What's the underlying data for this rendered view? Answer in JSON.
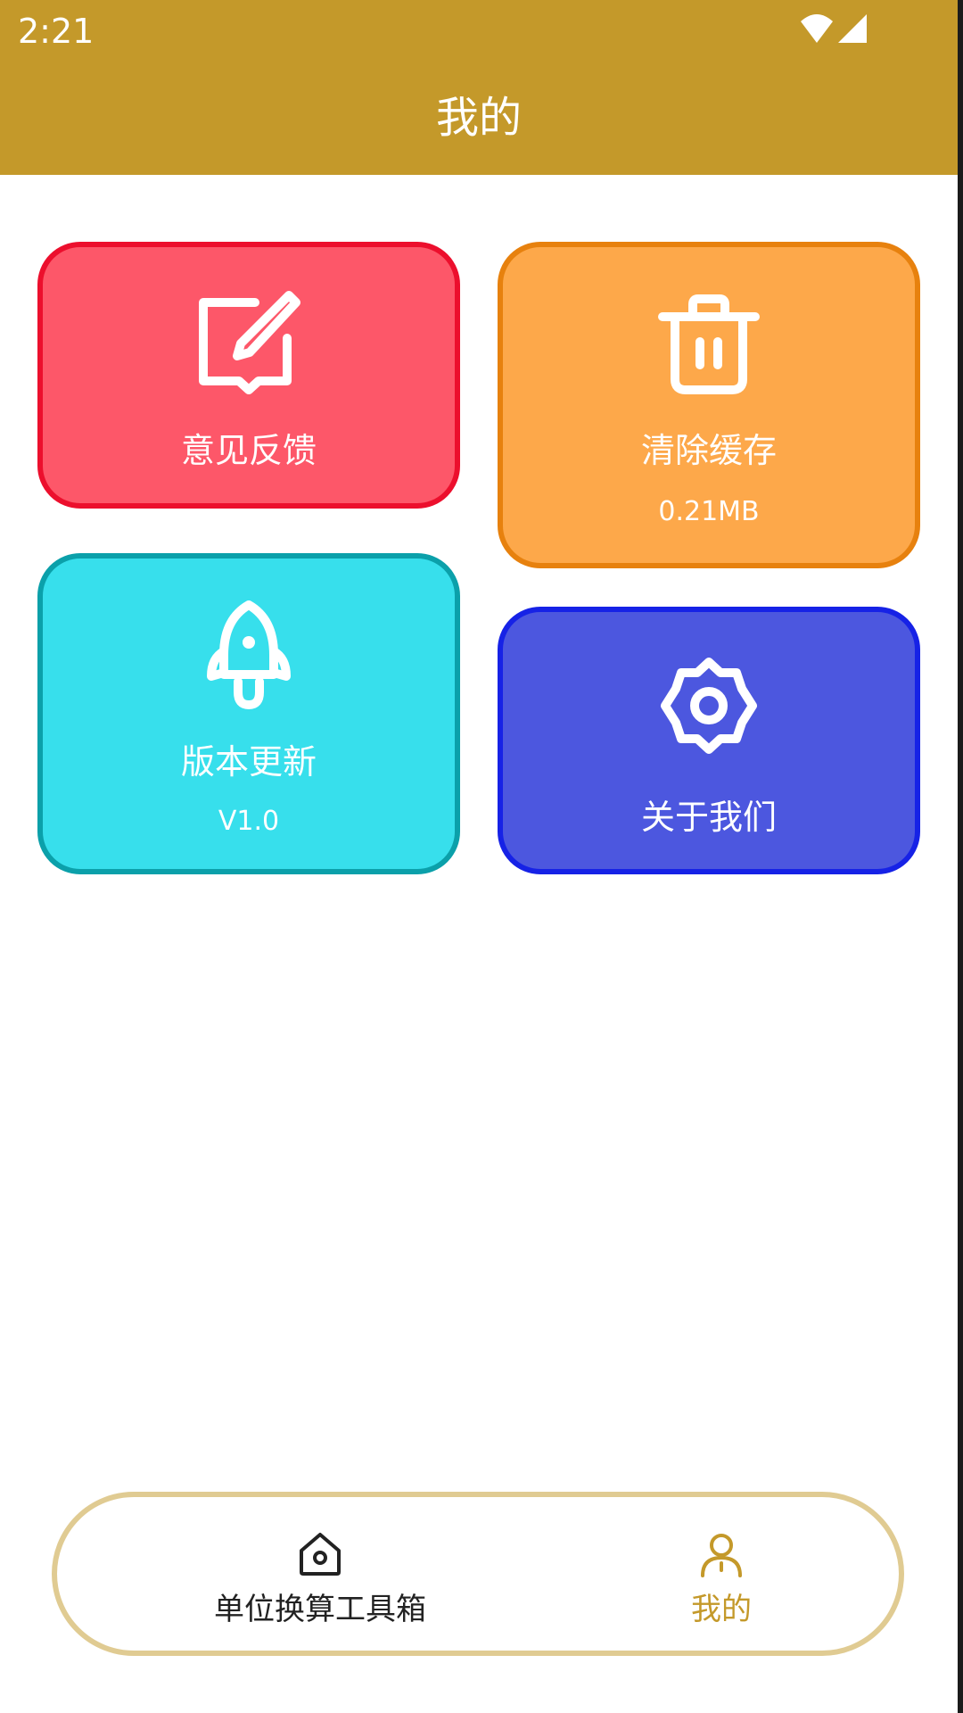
{
  "status_bar": {
    "time": "2:21"
  },
  "header": {
    "title": "我的"
  },
  "cards": {
    "feedback": {
      "label": "意见反馈",
      "icon": "edit-icon"
    },
    "clear_cache": {
      "label": "清除缓存",
      "value": "0.21MB",
      "icon": "trash-icon"
    },
    "version_update": {
      "label": "版本更新",
      "value": "V1.0",
      "icon": "rocket-icon"
    },
    "about_us": {
      "label": "关于我们",
      "icon": "gear-icon"
    }
  },
  "tab_bar": {
    "home": {
      "label": "单位换算工具箱",
      "icon": "home-icon"
    },
    "mine": {
      "label": "我的",
      "icon": "person-icon",
      "active": true
    }
  },
  "colors": {
    "accent": "#c4992a",
    "feedback_card": "#fd5769",
    "cache_card": "#fda84a",
    "update_card": "#37dfec",
    "about_card": "#4c57df",
    "tab_border": "#e0cb92"
  }
}
